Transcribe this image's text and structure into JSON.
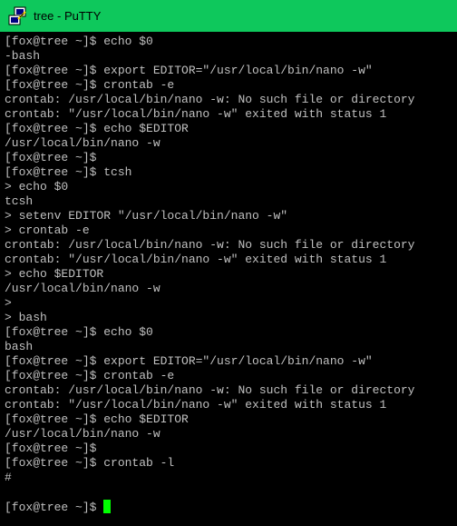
{
  "window": {
    "title": "tree - PuTTY",
    "icon": "putty-icon"
  },
  "terminal": {
    "lines": [
      "[fox@tree ~]$ echo $0",
      "-bash",
      "[fox@tree ~]$ export EDITOR=\"/usr/local/bin/nano -w\"",
      "[fox@tree ~]$ crontab -e",
      "crontab: /usr/local/bin/nano -w: No such file or directory",
      "crontab: \"/usr/local/bin/nano -w\" exited with status 1",
      "[fox@tree ~]$ echo $EDITOR",
      "/usr/local/bin/nano -w",
      "[fox@tree ~]$",
      "[fox@tree ~]$ tcsh",
      "> echo $0",
      "tcsh",
      "> setenv EDITOR \"/usr/local/bin/nano -w\"",
      "> crontab -e",
      "crontab: /usr/local/bin/nano -w: No such file or directory",
      "crontab: \"/usr/local/bin/nano -w\" exited with status 1",
      "> echo $EDITOR",
      "/usr/local/bin/nano -w",
      ">",
      "> bash",
      "[fox@tree ~]$ echo $0",
      "bash",
      "[fox@tree ~]$ export EDITOR=\"/usr/local/bin/nano -w\"",
      "[fox@tree ~]$ crontab -e",
      "crontab: /usr/local/bin/nano -w: No such file or directory",
      "crontab: \"/usr/local/bin/nano -w\" exited with status 1",
      "[fox@tree ~]$ echo $EDITOR",
      "/usr/local/bin/nano -w",
      "[fox@tree ~]$",
      "[fox@tree ~]$ crontab -l",
      "#",
      ""
    ],
    "prompt": "[fox@tree ~]$ ",
    "text_color": "#c0c0c0",
    "background_color": "#000000",
    "cursor_color": "#00ff00"
  },
  "colors": {
    "titlebar": "#0ec85c"
  }
}
